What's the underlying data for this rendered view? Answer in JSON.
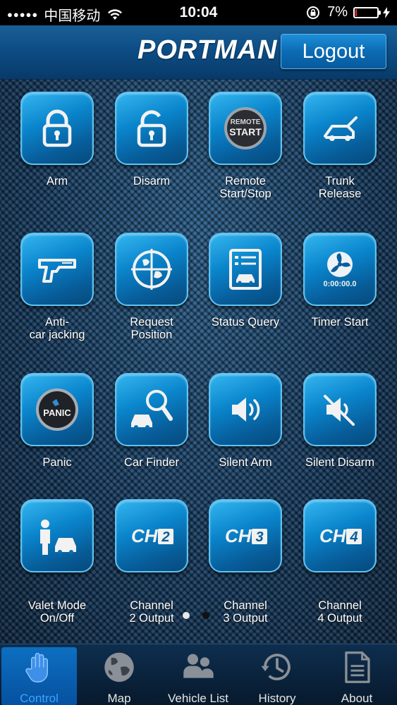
{
  "status_bar": {
    "signal_dots": "●●●●●",
    "carrier": "中国移动",
    "time": "10:04",
    "battery_text": "7%",
    "battery_level": 0.07,
    "battery_color": "#ff2b2b"
  },
  "header": {
    "brand": "PORTMAN",
    "logout_label": "Logout"
  },
  "grid": {
    "tiles": [
      {
        "label_1": "Arm",
        "label_2": "",
        "icon": "lock-closed-icon"
      },
      {
        "label_1": "Disarm",
        "label_2": "",
        "icon": "lock-open-icon"
      },
      {
        "label_1": "Remote",
        "label_2": "Start/Stop",
        "icon": "remote-start-icon",
        "icon_text_1": "REMOTE",
        "icon_text_2": "START"
      },
      {
        "label_1": "Trunk",
        "label_2": "Release",
        "icon": "trunk-icon"
      },
      {
        "label_1": "Anti-",
        "label_2": "car jacking",
        "icon": "gun-icon"
      },
      {
        "label_1": "Request",
        "label_2": "Position",
        "icon": "globe-target-icon"
      },
      {
        "label_1": "Status Query",
        "label_2": "",
        "icon": "status-list-icon"
      },
      {
        "label_1": "Timer Start",
        "label_2": "",
        "icon": "timer-fan-icon",
        "icon_text_1": "0:00:00.0"
      },
      {
        "label_1": "Panic",
        "label_2": "",
        "icon": "panic-icon",
        "icon_text_1": "PANIC"
      },
      {
        "label_1": "Car Finder",
        "label_2": "",
        "icon": "car-search-icon"
      },
      {
        "label_1": "Silent Arm",
        "label_2": "",
        "icon": "speaker-icon"
      },
      {
        "label_1": "Silent Disarm",
        "label_2": "",
        "icon": "speaker-mute-icon"
      },
      {
        "label_1": "Valet Mode",
        "label_2": "On/Off",
        "icon": "valet-icon"
      },
      {
        "label_1": "Channel",
        "label_2": "2 Output",
        "icon": "ch2-icon",
        "icon_text_1": "CH",
        "icon_text_2": "2"
      },
      {
        "label_1": "Channel",
        "label_2": "3 Output",
        "icon": "ch3-icon",
        "icon_text_1": "CH",
        "icon_text_2": "3"
      },
      {
        "label_1": "Channel",
        "label_2": "4 Output",
        "icon": "ch4-icon",
        "icon_text_1": "CH",
        "icon_text_2": "4"
      }
    ]
  },
  "tabs": [
    {
      "label": "Control",
      "icon": "hand-icon",
      "active": true
    },
    {
      "label": "Map",
      "icon": "globe-icon",
      "active": false
    },
    {
      "label": "Vehicle List",
      "icon": "people-icon",
      "active": false
    },
    {
      "label": "History",
      "icon": "history-icon",
      "active": false
    },
    {
      "label": "About",
      "icon": "document-icon",
      "active": false
    }
  ],
  "colors": {
    "accent": "#0a85cc",
    "tab_active": "#3aa4ff",
    "header": "#0d4d85"
  }
}
